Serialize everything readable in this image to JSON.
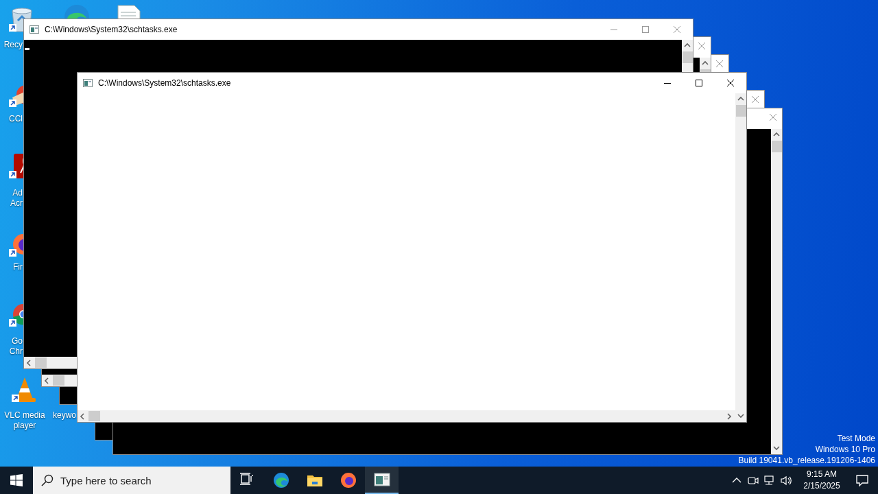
{
  "desktop": {
    "icons": [
      {
        "kind": "recycle-bin",
        "lines": [
          "Recy"
        ]
      },
      {
        "kind": "ccleaner",
        "lines": [
          "CCl"
        ]
      },
      {
        "kind": "acrobat",
        "lines": [
          "Ad",
          "Acr"
        ]
      },
      {
        "kind": "firefox",
        "lines": [
          "Fir"
        ]
      },
      {
        "kind": "chrome",
        "lines": [
          "Go",
          "Chr"
        ]
      },
      {
        "kind": "vlc",
        "lines": [
          "VLC media",
          "player"
        ]
      },
      {
        "kind": "edge"
      },
      {
        "kind": "file"
      },
      {
        "kind": "shortcut",
        "lines": [
          "keywo"
        ]
      }
    ],
    "system_info": [
      "Test Mode",
      "Windows 10 Pro",
      "Build 19041.vb_release.191206-1406"
    ]
  },
  "windows": [
    {
      "kind": "console",
      "active": false
    },
    {
      "kind": "console",
      "active": false
    },
    {
      "kind": "console",
      "active": false
    },
    {
      "kind": "console",
      "active": false
    },
    {
      "title": "C:\\Windows\\System32\\schtasks.exe",
      "kind": "console",
      "active": false,
      "cursor": true
    },
    {
      "title": "C:\\Windows\\System32\\schtasks.exe",
      "kind": "blank",
      "active": true
    }
  ],
  "taskbar": {
    "search": {
      "placeholder": "Type here to search"
    },
    "apps": [
      {
        "kind": "task-view",
        "selected": false
      },
      {
        "kind": "edge",
        "selected": false
      },
      {
        "kind": "explorer",
        "selected": false
      },
      {
        "kind": "firefox",
        "selected": false
      },
      {
        "kind": "console",
        "selected": true
      }
    ],
    "tray": {
      "time": "9:15 AM",
      "date": "2/15/2025"
    }
  }
}
